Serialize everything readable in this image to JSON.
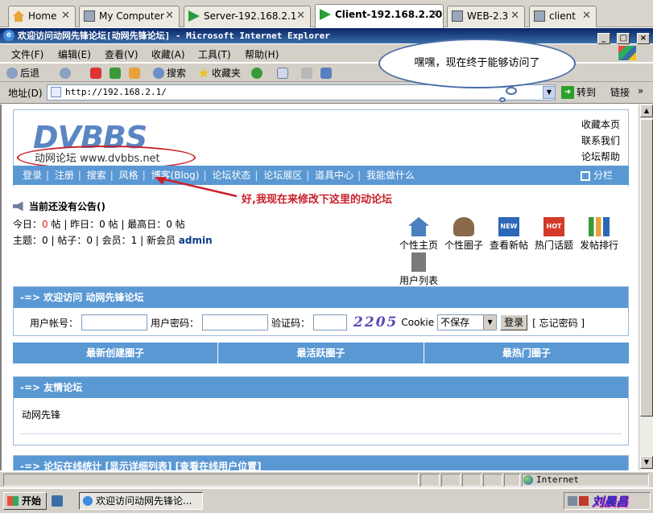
{
  "vm_tabs": [
    {
      "label": "Home",
      "active": false
    },
    {
      "label": "My Computer",
      "active": false
    },
    {
      "label": "Server-192.168.2.1",
      "active": false
    },
    {
      "label": "Client-192.168.2.20",
      "active": true
    },
    {
      "label": "WEB-2.3",
      "active": false
    },
    {
      "label": "client",
      "active": false
    }
  ],
  "window": {
    "title": "欢迎访问动网先锋论坛[动网先锋论坛] - Microsoft Internet Explorer",
    "minimize": "_",
    "maximize": "□",
    "close": "×"
  },
  "menu": [
    "文件(F)",
    "编辑(E)",
    "查看(V)",
    "收藏(A)",
    "工具(T)",
    "帮助(H)"
  ],
  "toolbar": {
    "back": "后退",
    "search": "搜索",
    "favorites": "收藏夹"
  },
  "address": {
    "label": "地址(D)",
    "url": "http://192.168.2.1/",
    "go": "转到",
    "links": "链接"
  },
  "callout": "嘿嘿，现在终于能够访问了",
  "annotation": "好,我现在来修改下这里的动论坛",
  "forum": {
    "logo": "DVBBS",
    "logo_sub": "动网论坛 www.dvbbs.net",
    "header_links": [
      "收藏本页",
      "联系我们",
      "论坛帮助"
    ],
    "nav": [
      "登录",
      "注册",
      "搜索",
      "风格",
      "博客(Blog)",
      "论坛状态",
      "论坛展区",
      "道具中心",
      "我能做什么"
    ],
    "nav_right": "分栏",
    "notice": "当前还没有公告()",
    "stats_line1": {
      "today_label": "今日：",
      "today": "0",
      "today_unit": "帖",
      "yesterday": "昨日：0 帖",
      "max": "最高日：0 帖"
    },
    "stats_line2": {
      "topics": "主题：0",
      "posts": "帖子：0",
      "members": "会员：1",
      "new_member_label": "新会员",
      "new_member": "admin"
    },
    "icons": [
      {
        "label": "个性主页",
        "icon": "home-icon",
        "color": "#4a7fc0"
      },
      {
        "label": "个性圈子",
        "icon": "group-icon",
        "color": "#8a6a4a"
      },
      {
        "label": "查看新帖",
        "icon": "new-post-icon",
        "color": "#2d68b8"
      },
      {
        "label": "热门话题",
        "icon": "hot-topic-icon",
        "color": "#d33a2a"
      },
      {
        "label": "发帖排行",
        "icon": "ranking-icon",
        "color": "#3a9a3a"
      },
      {
        "label": "用户列表",
        "icon": "user-list-icon",
        "color": "#7a7a7a"
      }
    ],
    "welcome_panel": {
      "title": "-=> 欢迎访问 动网先锋论坛",
      "username_label": "用户帐号：",
      "password_label": "用户密码：",
      "captcha_label": "验证码：",
      "captcha": "2205",
      "cookie_label": "Cookie",
      "cookie_value": "不保存",
      "login_button": "登录",
      "forgot": "[ 忘记密码 ]"
    },
    "circles": [
      "最新创建圈子",
      "最活跃圈子",
      "最热门圈子"
    ],
    "friends_panel": {
      "title": "-=> 友情论坛",
      "item": "动网先锋"
    },
    "online_panel": {
      "title": "-=> 论坛在线统计 [显示详细列表] [查看在线用户位置]"
    }
  },
  "status": {
    "zone": "Internet"
  },
  "taskbar": {
    "start": "开始",
    "task": "欢迎访问动网先锋论...",
    "watermark": "刘晨昌"
  }
}
